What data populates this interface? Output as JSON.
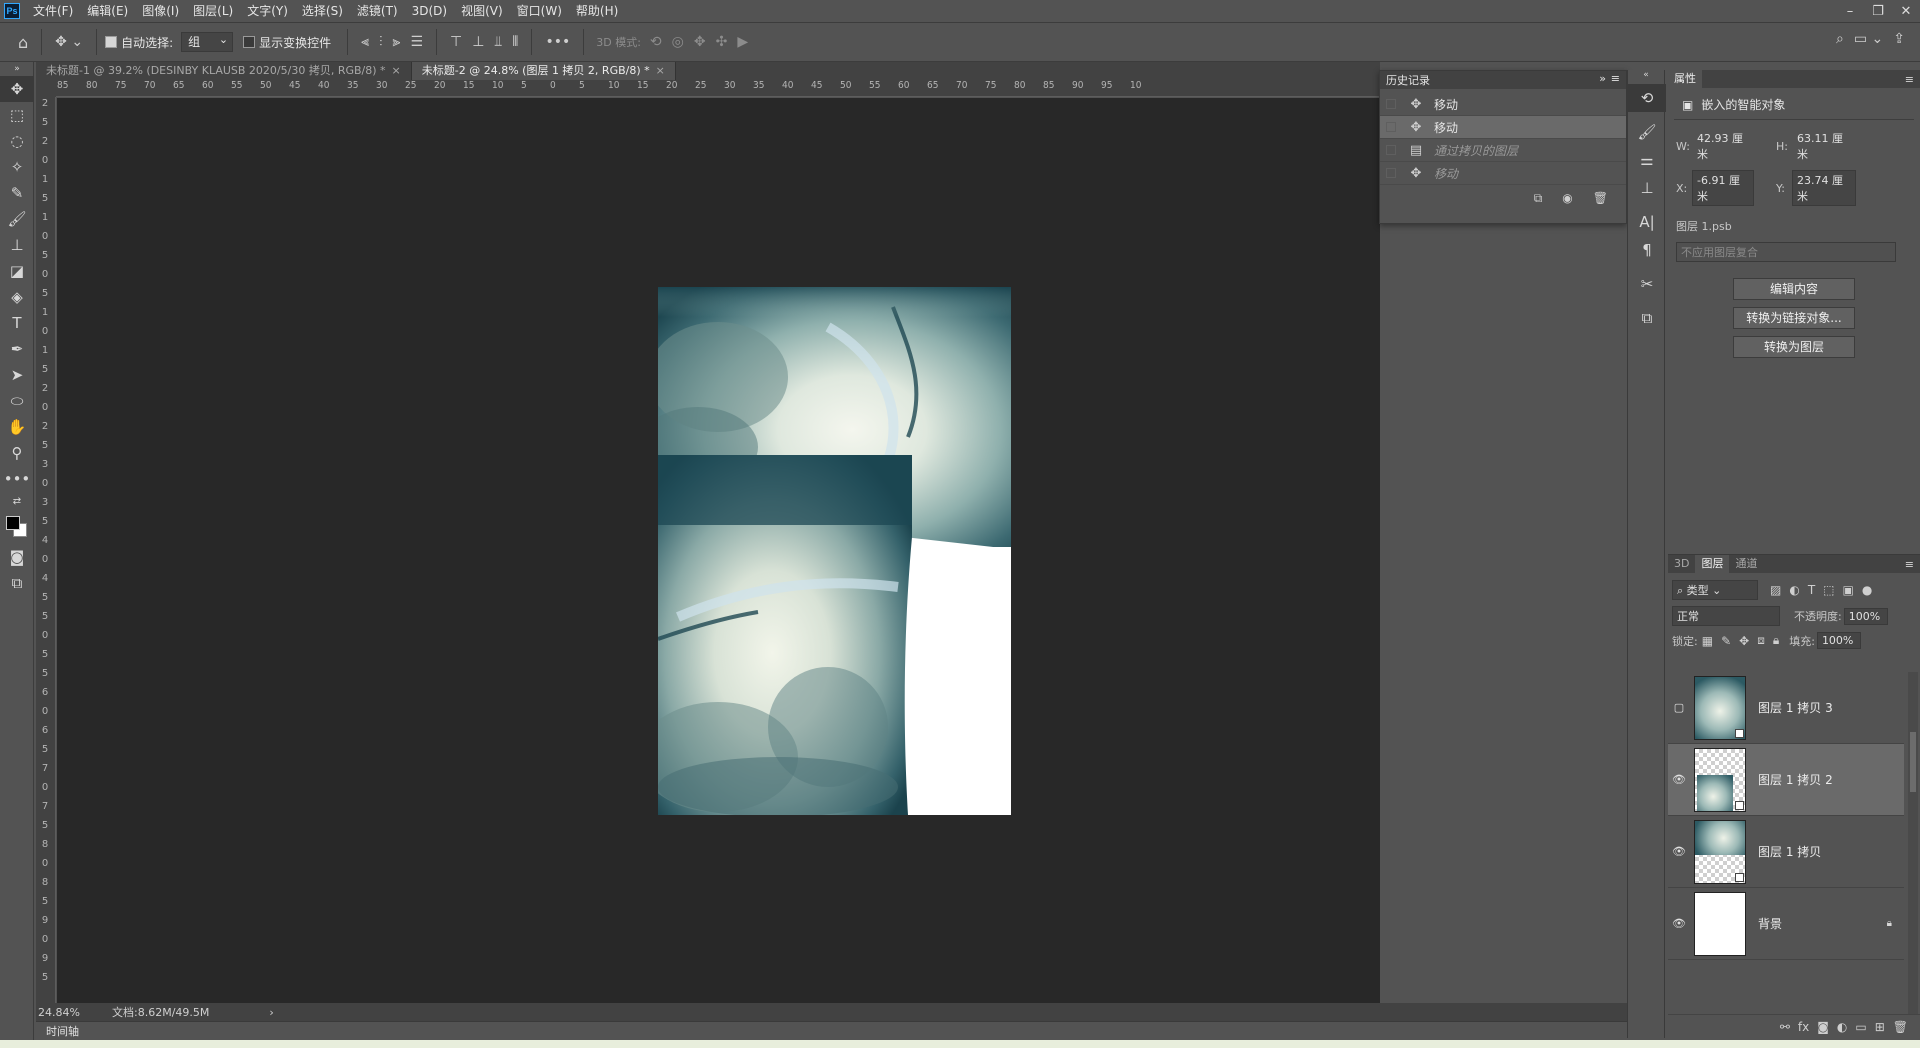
{
  "menubar": {
    "logo": "Ps",
    "items": [
      "文件(F)",
      "编辑(E)",
      "图像(I)",
      "图层(L)",
      "文字(Y)",
      "选择(S)",
      "滤镜(T)",
      "3D(D)",
      "视图(V)",
      "窗口(W)",
      "帮助(H)"
    ]
  },
  "options": {
    "auto_select_label": "自动选择:",
    "auto_select_value": "组",
    "show_transform_label": "显示变换控件",
    "mode_3d_label": "3D 模式:",
    "more": "•••"
  },
  "tabs": [
    {
      "title": "未标题-1 @ 39.2% (DESINBY KLAUSB   2020/5/30 拷贝, RGB/8) *",
      "close": "×"
    },
    {
      "title": "未标题-2 @ 24.8% (图层 1 拷贝 2, RGB/8) *",
      "close": "×"
    }
  ],
  "ruler": {
    "h_ticks": [
      "85",
      "80",
      "75",
      "70",
      "65",
      "60",
      "55",
      "50",
      "45",
      "40",
      "35",
      "30",
      "25",
      "20",
      "15",
      "10",
      "5",
      "0",
      "5",
      "10",
      "15",
      "20",
      "25",
      "30",
      "35",
      "40",
      "45",
      "50",
      "55",
      "60",
      "65",
      "70",
      "75",
      "80",
      "85",
      "90",
      "95",
      "10"
    ],
    "v_ticks": [
      "2",
      "5",
      "2",
      "0",
      "1",
      "5",
      "1",
      "0",
      "5",
      "0",
      "5",
      "1",
      "0",
      "1",
      "5",
      "2",
      "0",
      "2",
      "5",
      "3",
      "0",
      "3",
      "5",
      "4",
      "0",
      "4",
      "5",
      "5",
      "0",
      "5",
      "5",
      "6",
      "0",
      "6",
      "5",
      "7",
      "0",
      "7",
      "5",
      "8",
      "0",
      "8",
      "5",
      "9",
      "0",
      "9",
      "5"
    ]
  },
  "status": {
    "zoom": "24.84%",
    "doc": "文档:8.62M/49.5M",
    "arrow": "›"
  },
  "timeline": "时间轴",
  "history": {
    "title": "历史记录",
    "items": [
      {
        "label": "移动",
        "state": "normal"
      },
      {
        "label": "移动",
        "state": "selected"
      },
      {
        "label": "通过拷贝的图层",
        "state": "undone"
      },
      {
        "label": "移动",
        "state": "undone"
      }
    ]
  },
  "properties": {
    "title": "属性",
    "type": "嵌入的智能对象",
    "w_label": "W:",
    "w_value": "42.93 厘米",
    "h_label": "H:",
    "h_value": "63.11 厘米",
    "x_label": "X:",
    "x_value": "-6.91 厘米",
    "y_label": "Y:",
    "y_value": "23.74 厘米",
    "source_label": "图层 1.psb",
    "comp_placeholder": "不应用图层复合",
    "btn_edit": "编辑内容",
    "btn_convert_linked": "转换为链接对象...",
    "btn_convert_layer": "转换为图层"
  },
  "layers_panel": {
    "tabs": [
      "3D",
      "图层",
      "通道"
    ],
    "filter": "类型",
    "blend_mode": "正常",
    "opacity_label": "不透明度:",
    "opacity_value": "100%",
    "lock_label": "锁定:",
    "fill_label": "填充:",
    "fill_value": "100%",
    "layers": [
      {
        "name": "图层 1 拷贝 3",
        "visible": false,
        "selected": false
      },
      {
        "name": "图层 1 拷贝 2",
        "visible": true,
        "selected": true
      },
      {
        "name": "图层 1 拷贝",
        "visible": true,
        "selected": false
      },
      {
        "name": "背景",
        "visible": true,
        "selected": false
      }
    ]
  },
  "colors": {
    "canvas_bg": "#282828",
    "panel_bg": "#535353",
    "accent": "#31a8ff",
    "sky_dark": "#1e4a55",
    "sky_light": "#e8efe6"
  }
}
